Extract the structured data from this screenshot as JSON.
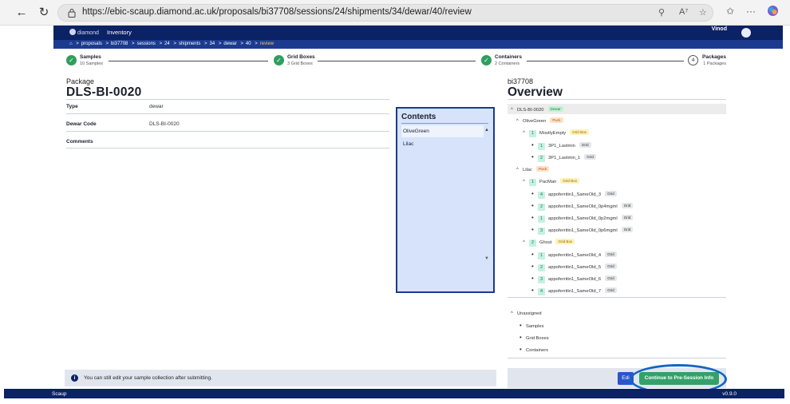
{
  "browser": {
    "url": "https://ebic-scaup.diamond.ac.uk/proposals/bi37708/sessions/24/shipments/34/dewar/40/review"
  },
  "header": {
    "logo_text": "diamond",
    "inventory_label": "Inventory",
    "user_name": "Vinod"
  },
  "breadcrumb": {
    "items": [
      "proposals",
      "bi37708",
      "sessions",
      "24",
      "shipments",
      "34",
      "dewar",
      "40",
      "review"
    ]
  },
  "stepper": {
    "steps": [
      {
        "title": "Samples",
        "subtitle": "10 Samples"
      },
      {
        "title": "Grid Boxes",
        "subtitle": "3 Grid Boxes"
      },
      {
        "title": "Containers",
        "subtitle": "2 Containers"
      },
      {
        "title": "Packages",
        "subtitle": "1 Packages",
        "number": "4"
      }
    ]
  },
  "package": {
    "label": "Package",
    "name": "DLS-BI-0020",
    "fields": [
      {
        "label": "Type",
        "value": "dewar"
      },
      {
        "label": "Dewar Code",
        "value": "DLS-BI-0020"
      },
      {
        "label": "Comments",
        "value": ""
      }
    ]
  },
  "contents": {
    "title": "Contents",
    "items": [
      "OliveGreen",
      "Lilac"
    ]
  },
  "info_banner": "You can still edit your sample collection after submitting.",
  "overview": {
    "proposal": "bi37708",
    "title": "Overview",
    "root": {
      "label": "DLS-BI-0020",
      "badge": "Dewar"
    },
    "pucks": [
      {
        "label": "OliveGreen",
        "badge": "Puck",
        "gridboxes": [
          {
            "num": "1",
            "label": "MostlyEmpty",
            "badge": "Grid Box",
            "grids": [
              {
                "num": "1",
                "label": "3P1_Lastmin",
                "badge": "Grid"
              },
              {
                "num": "2",
                "label": "3P1_Lastmin_1",
                "badge": "Grid"
              }
            ]
          }
        ]
      },
      {
        "label": "Lilac",
        "badge": "Puck",
        "gridboxes": [
          {
            "num": "1",
            "label": "PacMan",
            "badge": "Grid Box",
            "grids": [
              {
                "num": "4",
                "label": "appoferritin1_SameOld_3",
                "badge": "Grid"
              },
              {
                "num": "2",
                "label": "appoferritin1_SameOld_0p4mgml",
                "badge": "Grid"
              },
              {
                "num": "1",
                "label": "appoferritin1_SameOld_0p2mgml",
                "badge": "Grid"
              },
              {
                "num": "3",
                "label": "appoferritin1_SameOld_0p6mgml",
                "badge": "Grid"
              }
            ]
          },
          {
            "num": "2",
            "label": "Ghost",
            "badge": "Grid Box",
            "grids": [
              {
                "num": "1",
                "label": "appoferritin1_SameOld_4",
                "badge": "Grid"
              },
              {
                "num": "2",
                "label": "appoferritin1_SameOld_5",
                "badge": "Grid"
              },
              {
                "num": "3",
                "label": "appoferritin1_SameOld_6",
                "badge": "Grid"
              },
              {
                "num": "4",
                "label": "appoferritin1_SameOld_7",
                "badge": "Grid"
              }
            ]
          }
        ]
      }
    ],
    "unassigned": {
      "label": "Unassigned",
      "items": [
        "Samples",
        "Grid Boxes",
        "Containers"
      ]
    }
  },
  "actions": {
    "edit_label": "Edi",
    "continue_label": "Continue to Pre-Session Info"
  },
  "footer": {
    "app_name": "Scaup",
    "version": "v0.9.0"
  },
  "colors": {
    "navy": "#0b2264",
    "success": "#2f9e5e",
    "continue": "#34a06a",
    "contents_bg": "#d6e3fb"
  }
}
